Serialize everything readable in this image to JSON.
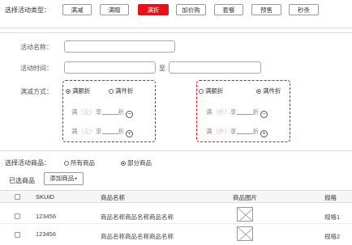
{
  "type_bar": {
    "label": "选择活动类型：",
    "buttons": [
      {
        "label": "满减",
        "active": false
      },
      {
        "label": "满赠",
        "active": false
      },
      {
        "label": "满折",
        "active": true
      },
      {
        "label": "加价购",
        "active": false
      },
      {
        "label": "套餐",
        "active": false
      },
      {
        "label": "预售",
        "active": false
      },
      {
        "label": "秒杀",
        "active": false
      }
    ]
  },
  "form": {
    "name_label": "活动名称：",
    "time_label": "活动时间：",
    "time_to": "至",
    "mode_label": "满减方式：",
    "left_box": {
      "option_a": "满额折",
      "option_b": "满件折",
      "selected": "option_a",
      "row_prefix": "满",
      "row_unit": "（元）",
      "row_mid": "享",
      "row_suffix": "折",
      "minus": "−",
      "plus": "+"
    },
    "right_box": {
      "option_a": "满额折",
      "option_b": "满件折",
      "selected": "option_b",
      "row_prefix": "满",
      "row_unit": "（件）",
      "row_mid": "享",
      "row_suffix": "折",
      "minus": "−",
      "plus": "+"
    }
  },
  "goods": {
    "select_label": "选择活动商品：",
    "opt_all": "所有商品",
    "opt_part": "部分商品",
    "selected": "opt_part",
    "selected_label": "已选商品",
    "add_button": "添加商品+"
  },
  "table": {
    "headers": [
      "SKUID",
      "商品名称",
      "商品图片",
      "规格"
    ],
    "rows": [
      {
        "skuid": "123456",
        "name": "商品名称商品名称商品名称",
        "spec": "规格1"
      },
      {
        "skuid": "123456",
        "name": "商品名称商品名称商品名称",
        "spec": "规格2"
      }
    ]
  }
}
